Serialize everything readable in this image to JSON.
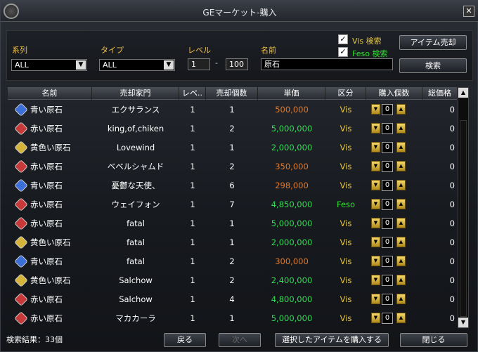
{
  "window": {
    "title": "GEマーケット-購入",
    "close": "✕"
  },
  "filter": {
    "lineage_label": "系列",
    "lineage_value": "ALL",
    "type_label": "タイプ",
    "type_value": "ALL",
    "level_label": "レベル",
    "level_min": "1",
    "level_sep": "-",
    "level_max": "100",
    "name_label": "名前",
    "name_value": "原石",
    "vis_label": "Vis 検索",
    "feso_label": "Feso 検索",
    "sell_button": "アイテム売却",
    "search_button": "検索",
    "check": "✓",
    "arrow_down": "▼"
  },
  "colors": {
    "vis": "#e8c840",
    "feso": "#33dd33",
    "orange": "#e07a2a",
    "green": "#33dd55",
    "accent": "#f0c040"
  },
  "columns": [
    "名前",
    "売却家門",
    "レベ..",
    "売却個数",
    "単価",
    "区分",
    "購入個数",
    "総価格"
  ],
  "rows": [
    {
      "gem": "blue",
      "name": "青い原石",
      "seller": "エクサランス",
      "level": "1",
      "count": "1",
      "price": "500,000",
      "price_color": "orange",
      "type": "Vis",
      "qty": "0",
      "total": "0"
    },
    {
      "gem": "red",
      "name": "赤い原石",
      "seller": "king,of,chiken",
      "level": "1",
      "count": "2",
      "price": "5,000,000",
      "price_color": "green",
      "type": "Vis",
      "qty": "0",
      "total": "0"
    },
    {
      "gem": "yellow",
      "name": "黄色い原石",
      "seller": "Lovewind",
      "level": "1",
      "count": "1",
      "price": "2,000,000",
      "price_color": "green",
      "type": "Vis",
      "qty": "0",
      "total": "0"
    },
    {
      "gem": "red",
      "name": "赤い原石",
      "seller": "ベベルシャムド",
      "level": "1",
      "count": "2",
      "price": "350,000",
      "price_color": "orange",
      "type": "Vis",
      "qty": "0",
      "total": "0"
    },
    {
      "gem": "blue",
      "name": "青い原石",
      "seller": "憂鬱な天使、",
      "level": "1",
      "count": "6",
      "price": "298,000",
      "price_color": "orange",
      "type": "Vis",
      "qty": "0",
      "total": "0"
    },
    {
      "gem": "red",
      "name": "赤い原石",
      "seller": "ウェイフォン",
      "level": "1",
      "count": "7",
      "price": "4,850,000",
      "price_color": "green",
      "type": "Feso",
      "qty": "0",
      "total": "0"
    },
    {
      "gem": "red",
      "name": "赤い原石",
      "seller": "fatal",
      "level": "1",
      "count": "1",
      "price": "5,000,000",
      "price_color": "green",
      "type": "Vis",
      "qty": "0",
      "total": "0"
    },
    {
      "gem": "yellow",
      "name": "黄色い原石",
      "seller": "fatal",
      "level": "1",
      "count": "1",
      "price": "2,000,000",
      "price_color": "green",
      "type": "Vis",
      "qty": "0",
      "total": "0"
    },
    {
      "gem": "blue",
      "name": "青い原石",
      "seller": "fatal",
      "level": "1",
      "count": "2",
      "price": "300,000",
      "price_color": "orange",
      "type": "Vis",
      "qty": "0",
      "total": "0"
    },
    {
      "gem": "yellow",
      "name": "黄色い原石",
      "seller": "Salchow",
      "level": "1",
      "count": "2",
      "price": "2,400,000",
      "price_color": "green",
      "type": "Vis",
      "qty": "0",
      "total": "0"
    },
    {
      "gem": "red",
      "name": "赤い原石",
      "seller": "Salchow",
      "level": "1",
      "count": "4",
      "price": "4,800,000",
      "price_color": "green",
      "type": "Vis",
      "qty": "0",
      "total": "0"
    },
    {
      "gem": "red",
      "name": "赤い原石",
      "seller": "マカカーラ",
      "level": "1",
      "count": "1",
      "price": "5,000,000",
      "price_color": "green",
      "type": "Vis",
      "qty": "0",
      "total": "0"
    }
  ],
  "footer": {
    "result": "検索結果：33個",
    "back": "戻る",
    "next": "次へ",
    "buy": "選択したアイテムを購入する",
    "close": "閉じる"
  },
  "scroll": {
    "up": "▲",
    "down": "▼"
  }
}
